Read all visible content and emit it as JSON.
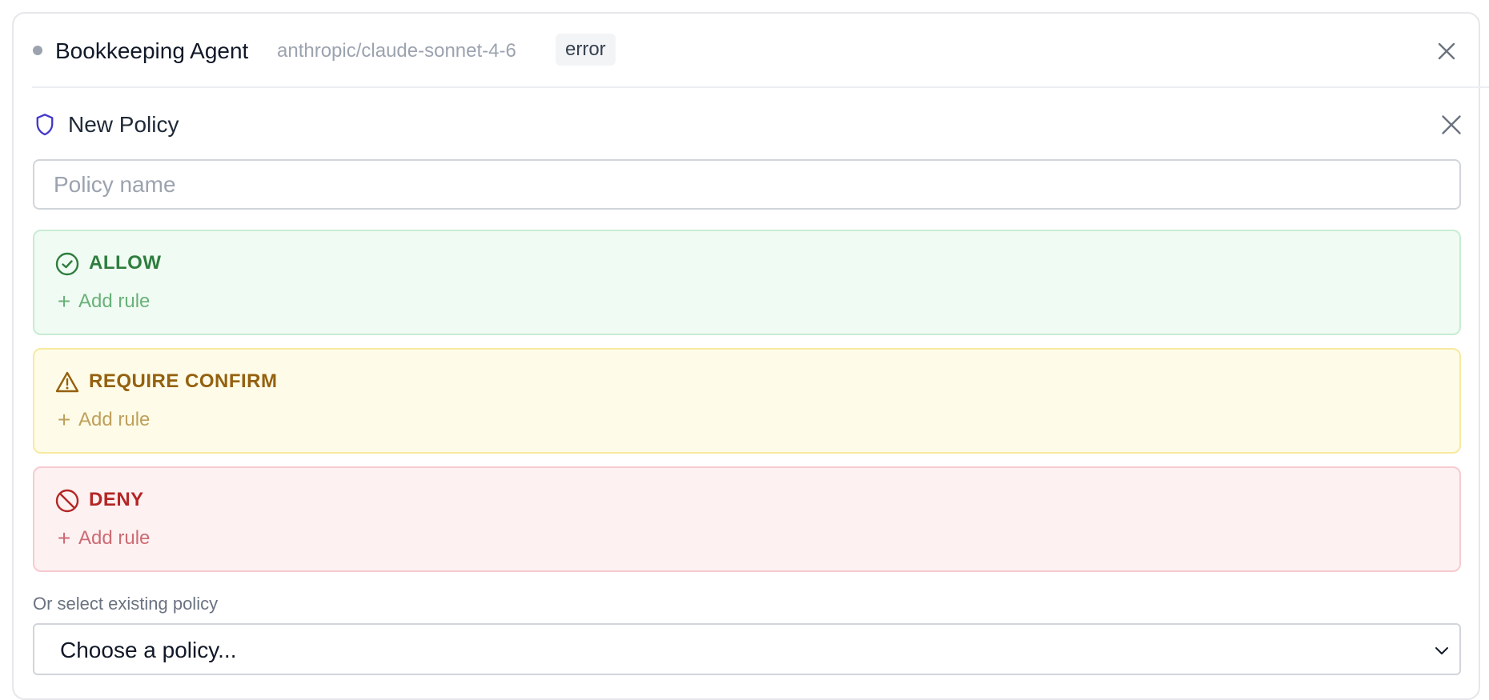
{
  "agent": {
    "name": "Bookkeeping Agent",
    "model": "anthropic/claude-sonnet-4-6",
    "status": "error",
    "status_dot_color": "#9ca3af"
  },
  "policy_form": {
    "title": "New Policy",
    "name_input": {
      "value": "",
      "placeholder": "Policy name"
    },
    "sections": [
      {
        "key": "allow",
        "label": "ALLOW",
        "icon": "check-circle-icon",
        "add_rule_label": "Add rule",
        "accent": "#2f7d3e",
        "background": "#f0fbf3"
      },
      {
        "key": "require_confirm",
        "label": "REQUIRE CONFIRM",
        "icon": "warning-triangle-icon",
        "add_rule_label": "Add rule",
        "accent": "#94610f",
        "background": "#fefce8"
      },
      {
        "key": "deny",
        "label": "DENY",
        "icon": "prohibited-icon",
        "add_rule_label": "Add rule",
        "accent": "#b42626",
        "background": "#fdf1f2"
      }
    ],
    "existing_policy": {
      "label": "Or select existing policy",
      "selected": "Choose a policy..."
    }
  },
  "icons": {
    "header_close": "close-icon",
    "policy_icon": "shield-icon",
    "policy_close": "close-icon",
    "add": "plus-icon",
    "select": "chevron-down-icon"
  }
}
